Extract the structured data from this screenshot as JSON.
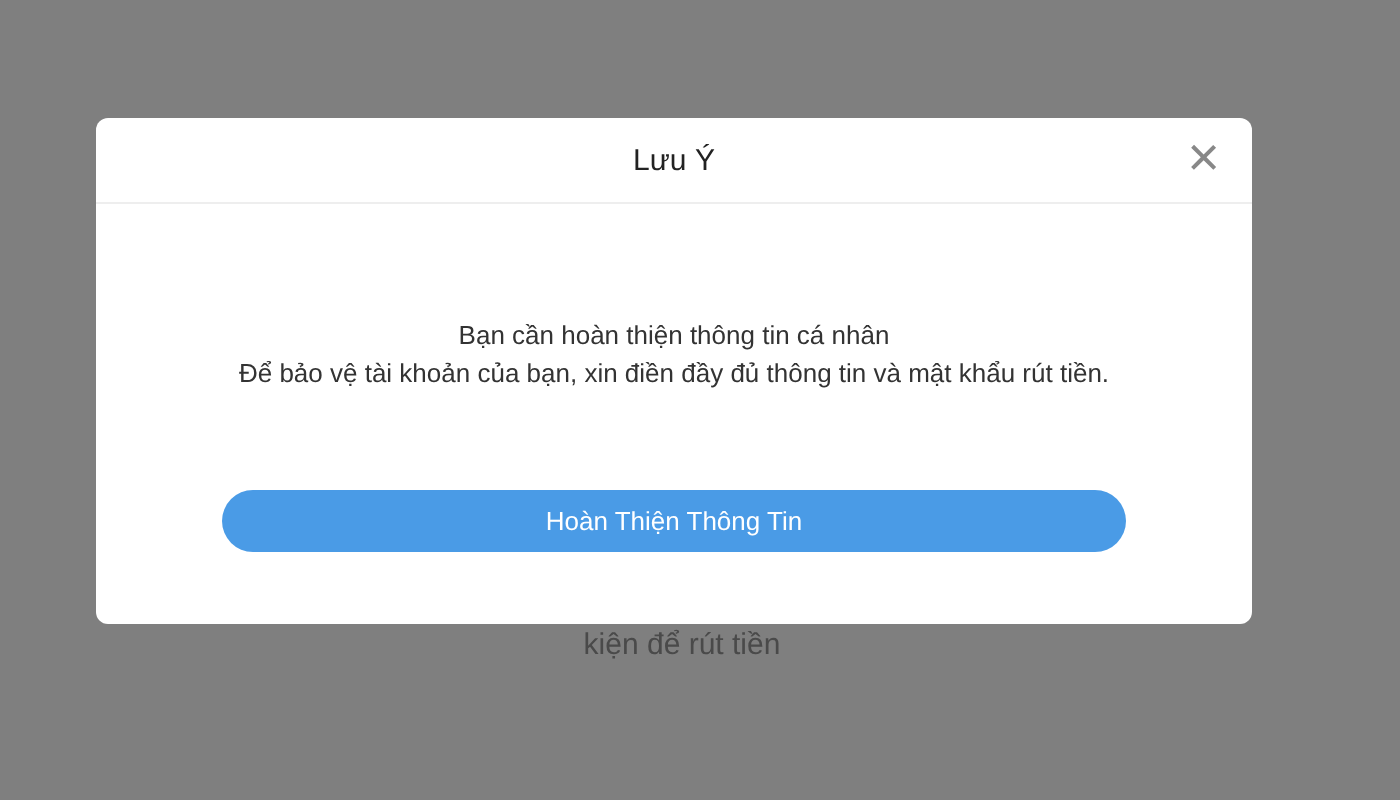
{
  "background": {
    "text": "kiện để rút tiền"
  },
  "dialog": {
    "title": "Lưu Ý",
    "close": "×",
    "message": [
      "Bạn cần hoàn thiện thông tin cá nhân",
      "Để bảo vệ tài khoản của bạn, xin điền đầy đủ thông tin và mật khẩu rút tiền."
    ],
    "button": "Hoàn Thiện Thông Tin"
  }
}
